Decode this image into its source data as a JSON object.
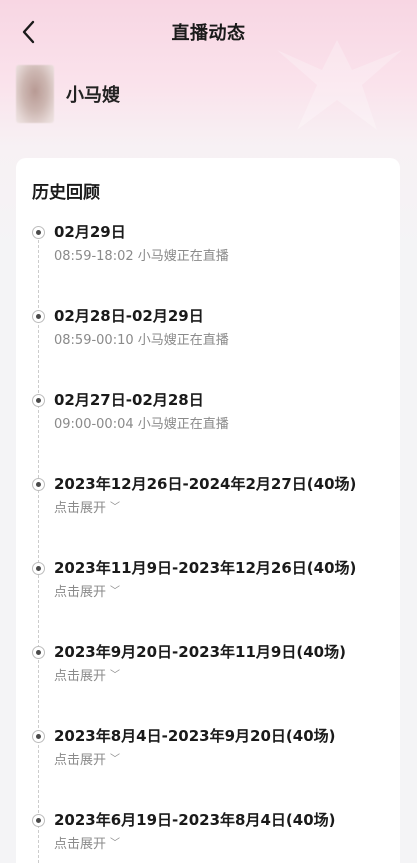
{
  "header": {
    "title": "直播动态"
  },
  "anchor": {
    "name": "小马嫂"
  },
  "history": {
    "section_title": "历史回顾",
    "items": [
      {
        "title": "02月29日",
        "subtitle": "08:59-18:02 小马嫂正在直播"
      },
      {
        "title": "02月28日-02月29日",
        "subtitle": "08:59-00:10 小马嫂正在直播"
      },
      {
        "title": "02月27日-02月28日",
        "subtitle": "09:00-00:04 小马嫂正在直播"
      },
      {
        "title": "2023年12月26日-2024年2月27日(40场)",
        "subtitle": "点击展开"
      },
      {
        "title": "2023年11月9日-2023年12月26日(40场)",
        "subtitle": "点击展开"
      },
      {
        "title": "2023年9月20日-2023年11月9日(40场)",
        "subtitle": "点击展开"
      },
      {
        "title": "2023年8月4日-2023年9月20日(40场)",
        "subtitle": "点击展开"
      },
      {
        "title": "2023年6月19日-2023年8月4日(40场)",
        "subtitle": "点击展开"
      }
    ]
  },
  "icons": {
    "back": "chevron-left-icon",
    "expand": "chevron-down-icon"
  }
}
